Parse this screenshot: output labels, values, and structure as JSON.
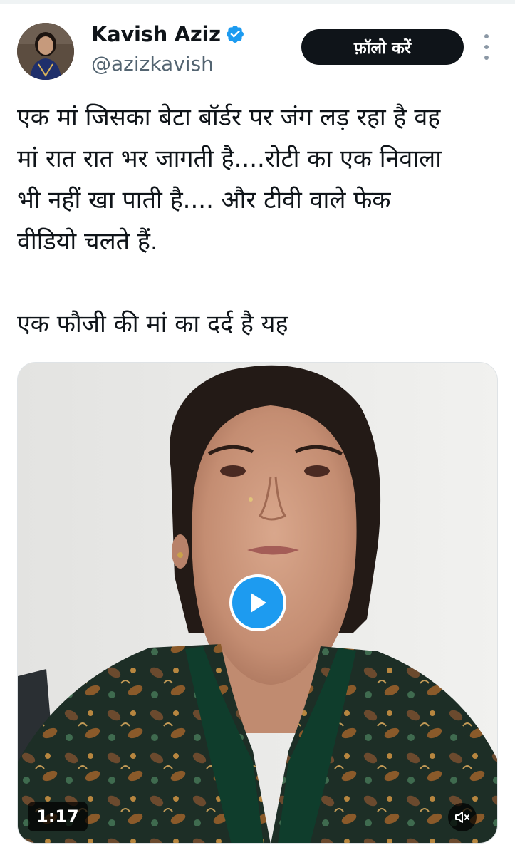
{
  "author": {
    "display_name": "Kavish Aziz",
    "handle": "@azizkavish",
    "verified": true,
    "avatar_icon": "profile-avatar"
  },
  "actions": {
    "follow_label": "फ़ॉलो करें",
    "more_icon": "more-vertical-icon"
  },
  "tweet": {
    "text": "एक मां जिसका बेटा बॉर्डर पर जंग लड़ रहा है वह\nमां रात रात भर जागती है....रोटी का एक निवाला\nभी नहीं खा पाती है.... और टीवी वाले फेक\nवीडियो चलते हैं.\n\nएक फौजी की मां का दर्द है यह"
  },
  "media": {
    "type": "video",
    "duration": "1:17",
    "play_icon": "play-icon",
    "mute_icon": "speaker-muted-icon"
  },
  "colors": {
    "accent": "#1d9bf0",
    "text": "#0f1419",
    "secondary_text": "#536471",
    "follow_button": "#0f1419"
  }
}
